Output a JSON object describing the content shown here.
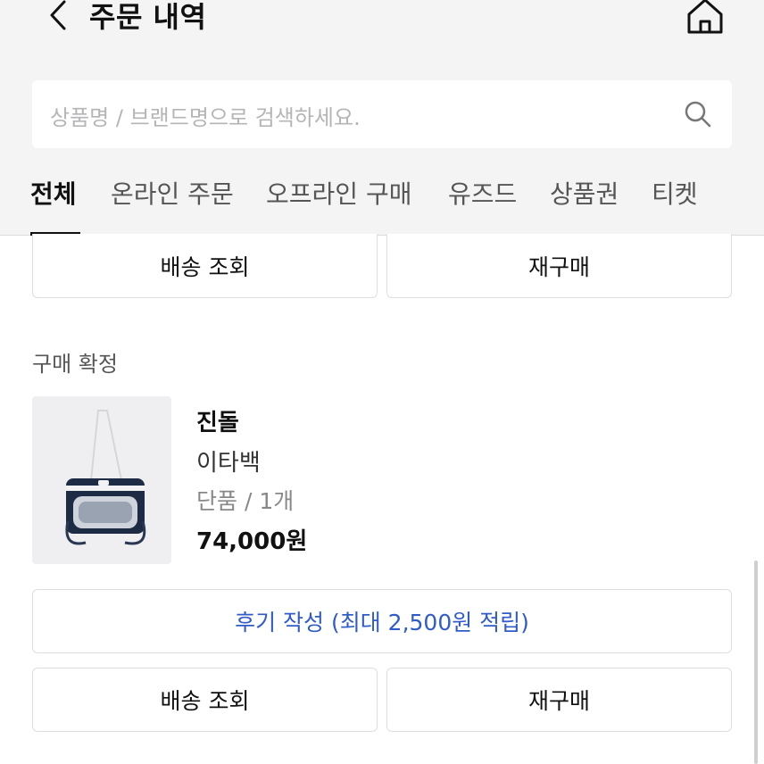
{
  "header": {
    "title": "주문 내역",
    "back_icon": "chevron-left-icon",
    "home_icon": "home-icon"
  },
  "search": {
    "placeholder": "상품명 / 브랜드명으로 검색하세요.",
    "icon": "search-icon"
  },
  "tabs": [
    {
      "label": "전체",
      "active": true
    },
    {
      "label": "온라인 주문",
      "active": false
    },
    {
      "label": "오프라인 구매",
      "active": false
    },
    {
      "label": "유즈드",
      "active": false
    },
    {
      "label": "상품권",
      "active": false
    },
    {
      "label": "티켓",
      "active": false
    }
  ],
  "order_prev": {
    "track_label": "배송 조회",
    "rebuy_label": "재구매"
  },
  "order": {
    "status": "구매 확정",
    "brand": "진돌",
    "product_name": "이타백",
    "option": "단품 / 1개",
    "price": "74,000원",
    "review_label": "후기 작성 (최대 2,500원 적립)",
    "track_label": "배송 조회",
    "rebuy_label": "재구매"
  },
  "colors": {
    "accent_link": "#2f5cc9",
    "header_bg": "#f4f4f5"
  }
}
